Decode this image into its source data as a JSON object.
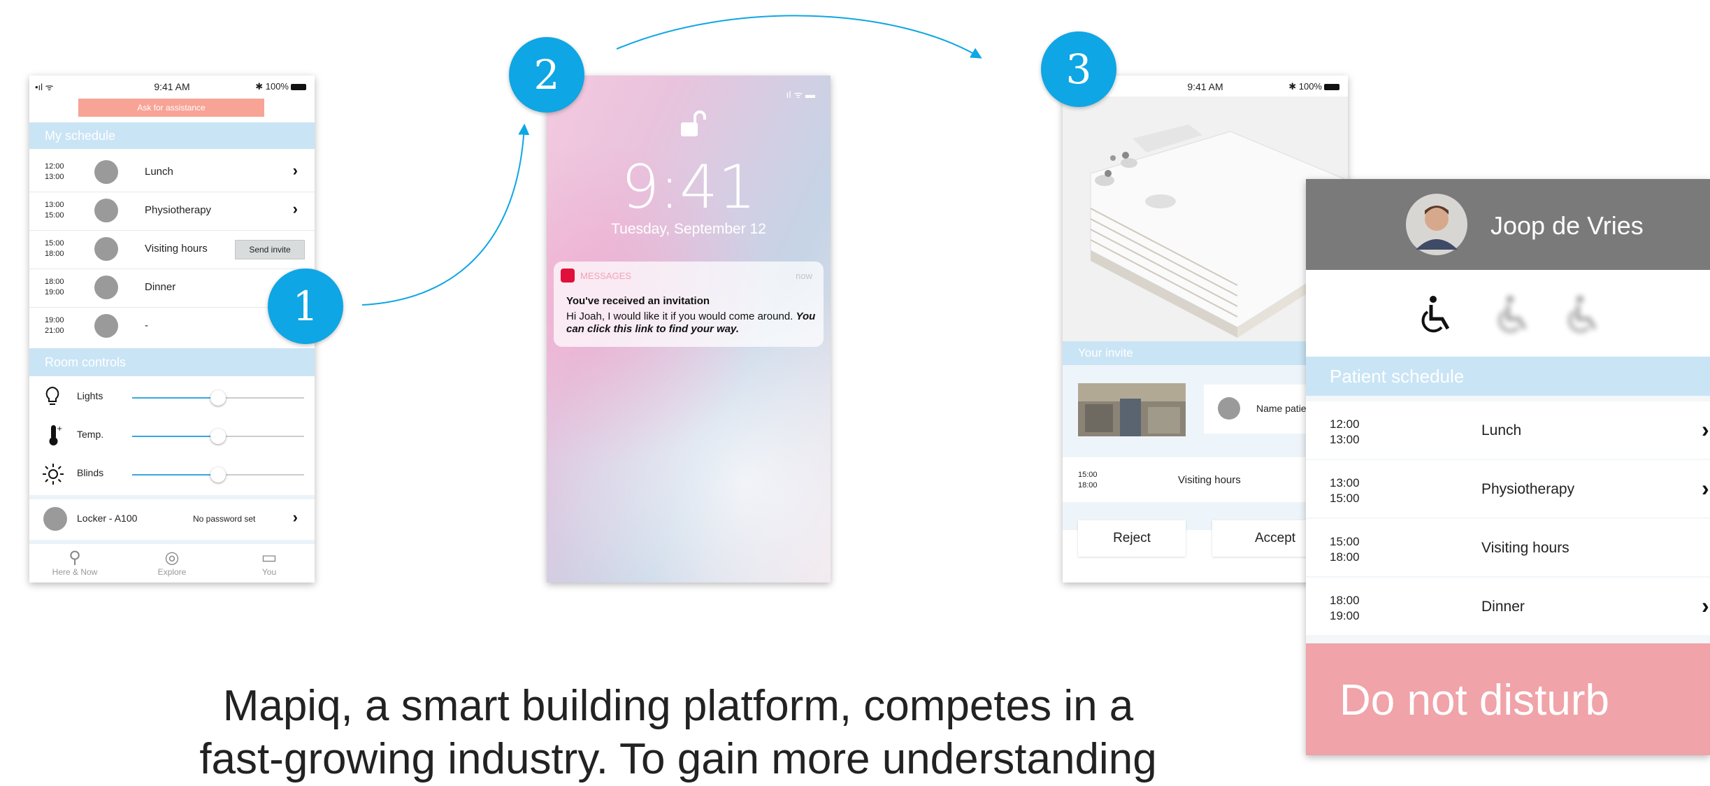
{
  "phone1": {
    "status": {
      "signal": "•ıl ᯤ",
      "time": "9:41 AM",
      "battery": "✱ 100%"
    },
    "assist_button": "Ask for assistance",
    "schedule_header": "My schedule",
    "schedule": [
      {
        "start": "12:00",
        "end": "13:00",
        "label": "Lunch",
        "chevron": true
      },
      {
        "start": "13:00",
        "end": "15:00",
        "label": "Physiotherapy",
        "chevron": true
      },
      {
        "start": "15:00",
        "end": "18:00",
        "label": "Visiting hours",
        "action": "Send invite"
      },
      {
        "start": "18:00",
        "end": "19:00",
        "label": "Dinner"
      },
      {
        "start": "19:00",
        "end": "21:00",
        "label": "-"
      }
    ],
    "room_controls_header": "Room controls",
    "controls": [
      {
        "label": "Lights",
        "icon": "lightbulb-icon",
        "level": 0.5
      },
      {
        "label": "Temp.",
        "icon": "thermometer-icon",
        "level": 0.5
      },
      {
        "label": "Blinds",
        "icon": "sun-icon",
        "level": 0.5
      }
    ],
    "locker": {
      "label": "Locker - A100",
      "status": "No password set"
    },
    "nav": [
      {
        "label": "Here & Now",
        "icon": "location-pin-icon"
      },
      {
        "label": "Explore",
        "icon": "compass-icon"
      },
      {
        "label": "You",
        "icon": "id-card-icon"
      }
    ]
  },
  "badges": [
    "1",
    "2",
    "3"
  ],
  "phone2": {
    "time": "9:41",
    "date": "Tuesday, September 12",
    "notification": {
      "app": "MESSAGES",
      "when": "now",
      "title": "You've received an invitation",
      "body": "Hi Joah, I would like it if you would come around.",
      "link": "You can click this link to find your way."
    }
  },
  "phone3": {
    "status": {
      "time": "9:41 AM",
      "battery": "✱ 100%"
    },
    "invite_header": "Your invite",
    "name_field": "Name patie",
    "visit": {
      "start": "15:00",
      "end": "18:00",
      "label": "Visiting hours"
    },
    "reject": "Reject",
    "accept": "Accept"
  },
  "panel": {
    "name": "Joop de Vries",
    "schedule_header": "Patient schedule",
    "icons": [
      "wheelchair-icon",
      "wheelchair-icon",
      "wheelchair-icon"
    ],
    "schedule": [
      {
        "start": "12:00",
        "end": "13:00",
        "label": "Lunch",
        "chevron": true
      },
      {
        "start": "13:00",
        "end": "15:00",
        "label": "Physiotherapy",
        "chevron": true
      },
      {
        "start": "15:00",
        "end": "18:00",
        "label": "Visiting hours"
      },
      {
        "start": "18:00",
        "end": "19:00",
        "label": "Dinner",
        "chevron": true
      }
    ],
    "dnd": "Do not disturb",
    "colors": {
      "header": "#7a7a7a",
      "section": "#c9e4f5",
      "dnd": "#f0a3a8"
    }
  },
  "caption": {
    "line1": "Mapiq, a smart building platform, competes in a",
    "line2": "fast-growing industry. To gain more understanding"
  },
  "colors": {
    "accent": "#0ea6e4",
    "assist": "#f7a396"
  }
}
